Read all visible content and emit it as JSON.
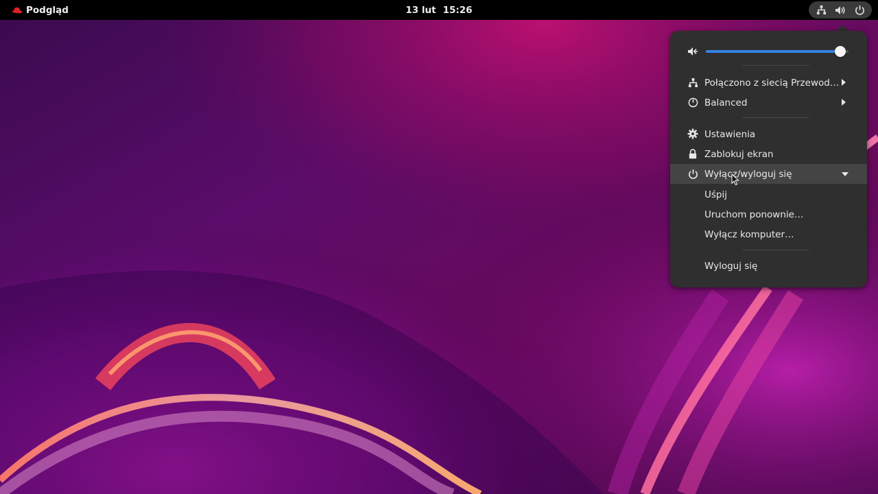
{
  "topbar": {
    "activities_label": "Podgląd",
    "clock_date": "13 lut",
    "clock_time": "15:26",
    "status_icons": [
      "network-wired-icon",
      "volume-icon",
      "power-icon"
    ]
  },
  "menu": {
    "volume": {
      "icon": "speaker-icon",
      "level": 0.94
    },
    "network": {
      "label": "Połączono z siecią Przewod…",
      "icon": "network-wired-icon"
    },
    "power_mode": {
      "label": "Balanced",
      "icon": "power-profile-icon"
    },
    "settings": {
      "label": "Ustawienia",
      "icon": "gear-icon"
    },
    "lock": {
      "label": "Zablokuj ekran",
      "icon": "lock-icon"
    },
    "power_off_logout": {
      "label": "Wyłącz/wyloguj się",
      "icon": "power-icon",
      "expanded": true,
      "items": [
        "Uśpij",
        "Uruchom ponownie…",
        "Wyłącz komputer…"
      ],
      "logout_label": "Wyloguj się"
    }
  },
  "colors": {
    "accent": "#3584e4",
    "menu_bg": "#2f2f2f",
    "topbar_bg": "#000000"
  }
}
